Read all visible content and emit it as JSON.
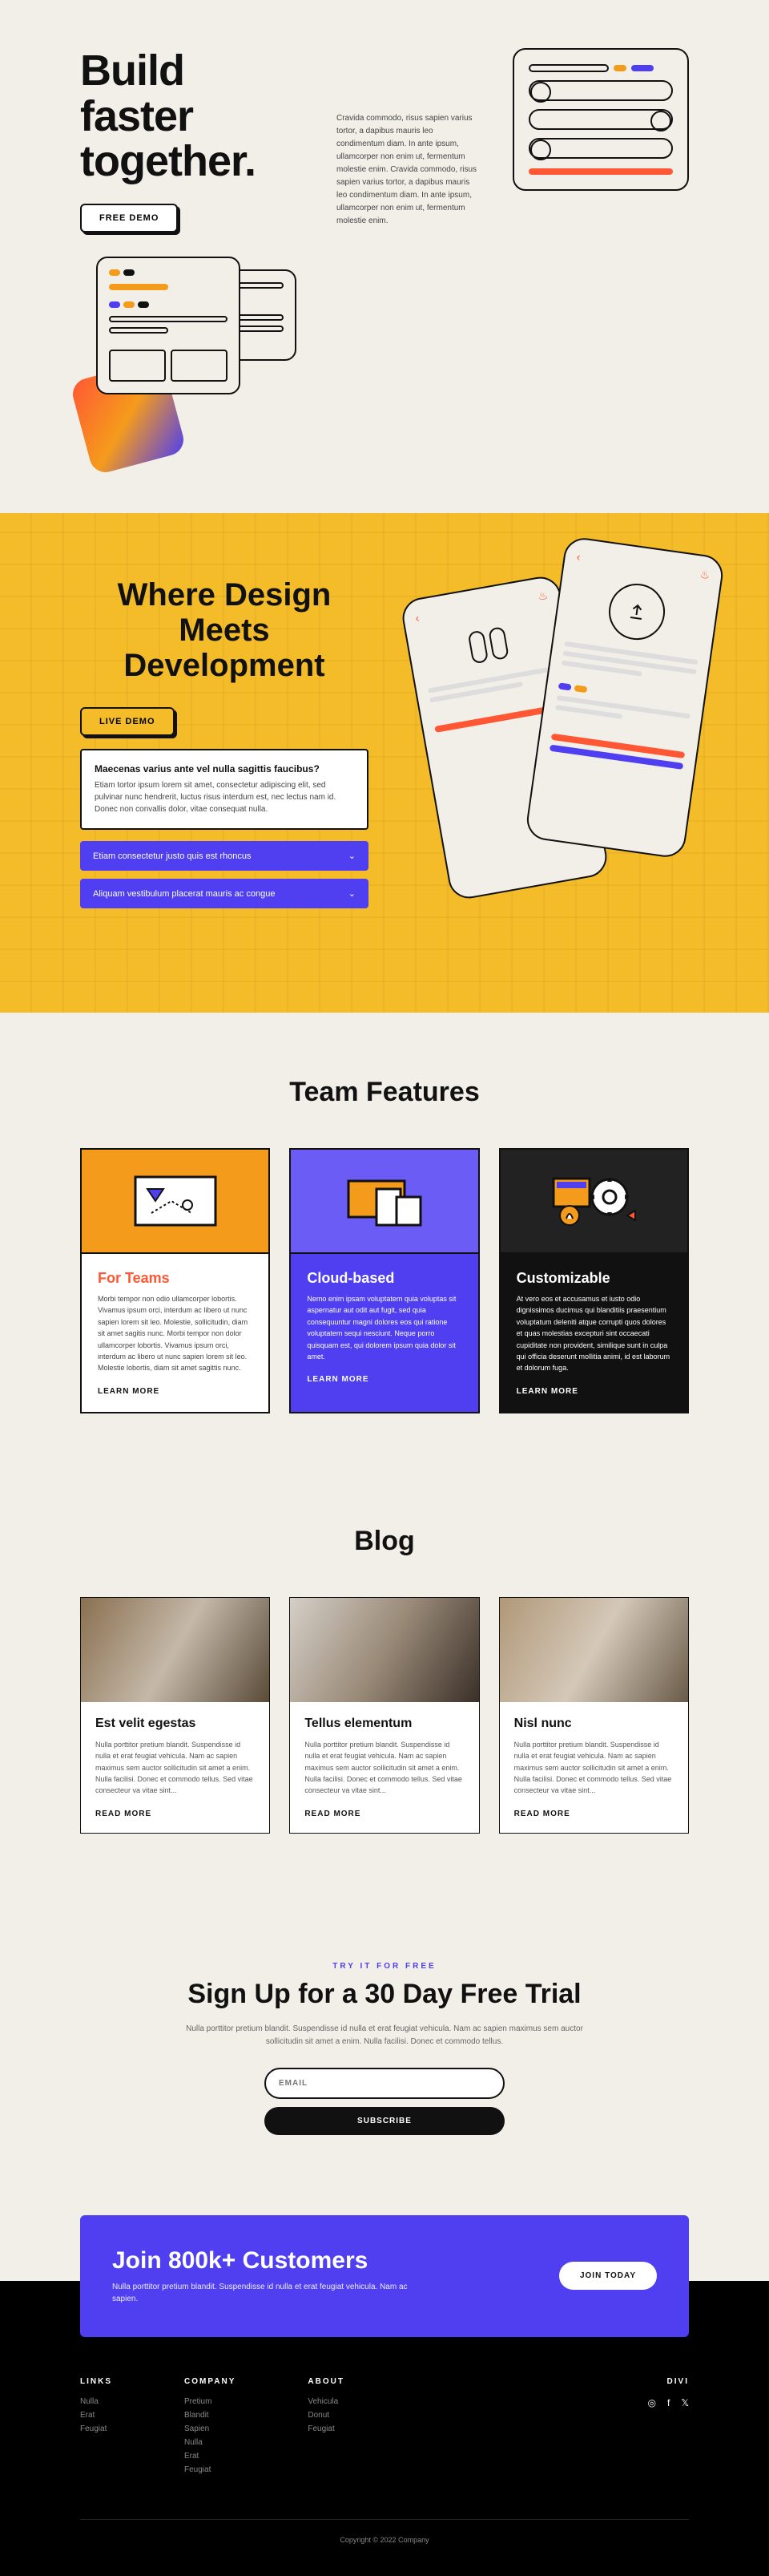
{
  "hero": {
    "title": "Build faster together.",
    "cta": "FREE DEMO",
    "desc": "Cravida commodo, risus sapien varius tortor, a dapibus mauris leo condimentum diam. In ante ipsum, ullamcorper non enim ut, fermentum molestie enim. Cravida commodo, risus sapien varius tortor, a dapibus mauris leo condimentum diam. In ante ipsum, ullamcorper non enim ut, fermentum molestie enim."
  },
  "yellow": {
    "title": "Where Design Meets Development",
    "cta": "LIVE DEMO",
    "info_q": "Maecenas varius ante vel nulla sagittis faucibus?",
    "info_a": "Etiam tortor ipsum lorem sit amet, consectetur adipiscing elit, sed pulvinar nunc hendrerit, luctus risus interdum est, nec lectus nam id. Donec non convallis dolor, vitae consequat nulla.",
    "acc1": "Etiam consectetur justo quis est rhoncus",
    "acc2": "Aliquam vestibulum placerat mauris ac congue"
  },
  "features": {
    "heading": "Team Features",
    "cards": [
      {
        "name": "For Teams",
        "desc": "Morbi tempor non odio ullamcorper lobortis. Vivamus ipsum orci, interdum ac libero ut nunc sapien lorem sit leo. Molestie, sollicitudin, diam sit amet sagitis nunc. Morbi tempor non dolor ullamcorper lobortis. Vivamus ipsum orci, interdum ac libero ut nunc sapien lorem sit leo. Molestie lobortis, diam sit amet sagittis nunc.",
        "link": "LEARN MORE"
      },
      {
        "name": "Cloud-based",
        "desc": "Nemo enim ipsam voluptatem quia voluptas sit aspernatur aut odit aut fugit, sed quia consequuntur magni dolores eos qui ratione voluptatem sequi nesciunt. Neque porro quisquam est, qui dolorem ipsum quia dolor sit amet.",
        "link": "LEARN MORE"
      },
      {
        "name": "Customizable",
        "desc": "At vero eos et accusamus et iusto odio dignissimos ducimus qui blanditiis praesentium voluptatum deleniti atque corrupti quos dolores et quas molestias excepturi sint occaecati cupiditate non provident, similique sunt in culpa qui officia deserunt mollitia animi, id est laborum et dolorum fuga.",
        "link": "LEARN MORE"
      }
    ]
  },
  "blog": {
    "heading": "Blog",
    "posts": [
      {
        "title": "Est velit egestas",
        "excerpt": "Nulla porttitor pretium blandit. Suspendisse id nulla et erat feugiat vehicula. Nam ac sapien maximus sem auctor sollicitudin sit amet a enim. Nulla facilisi. Donec et commodo tellus. Sed vitae consecteur va vitae sint...",
        "link": "READ MORE"
      },
      {
        "title": "Tellus elementum",
        "excerpt": "Nulla porttitor pretium blandit. Suspendisse id nulla et erat feugiat vehicula. Nam ac sapien maximus sem auctor sollicitudin sit amet a enim. Nulla facilisi. Donec et commodo tellus. Sed vitae consecteur va vitae sint...",
        "link": "READ MORE"
      },
      {
        "title": "Nisl nunc",
        "excerpt": "Nulla porttitor pretium blandit. Suspendisse id nulla et erat feugiat vehicula. Nam ac sapien maximus sem auctor sollicitudin sit amet a enim. Nulla facilisi. Donec et commodo tellus. Sed vitae consecteur va vitae sint...",
        "link": "READ MORE"
      }
    ]
  },
  "trial": {
    "tag": "TRY IT FOR FREE",
    "title": "Sign Up for a 30 Day Free Trial",
    "desc": "Nulla porttitor pretium blandit. Suspendisse id nulla et erat feugiat vehicula. Nam ac sapien maximus sem auctor sollicitudin sit amet a enim. Nulla facilisi. Donec et commodo tellus.",
    "placeholder": "EMAIL",
    "button": "SUBSCRIBE"
  },
  "join": {
    "title": "Join 800k+ Customers",
    "desc": "Nulla porttitor pretium blandit. Suspendisse id nulla et erat feugiat vehicula. Nam ac sapien.",
    "button": "JOIN TODAY"
  },
  "footer": {
    "cols": [
      {
        "h": "LINKS",
        "items": [
          "Nulla",
          "Erat",
          "Feugiat"
        ]
      },
      {
        "h": "COMPANY",
        "items": [
          "Pretium",
          "Blandit",
          "Sapien",
          "Nulla",
          "Erat",
          "Feugiat"
        ]
      },
      {
        "h": "ABOUT",
        "items": [
          "Vehicula",
          "Donut",
          "Feugiat"
        ]
      }
    ],
    "brand": "DIVI",
    "copy": "Copyright © 2022 Company"
  }
}
